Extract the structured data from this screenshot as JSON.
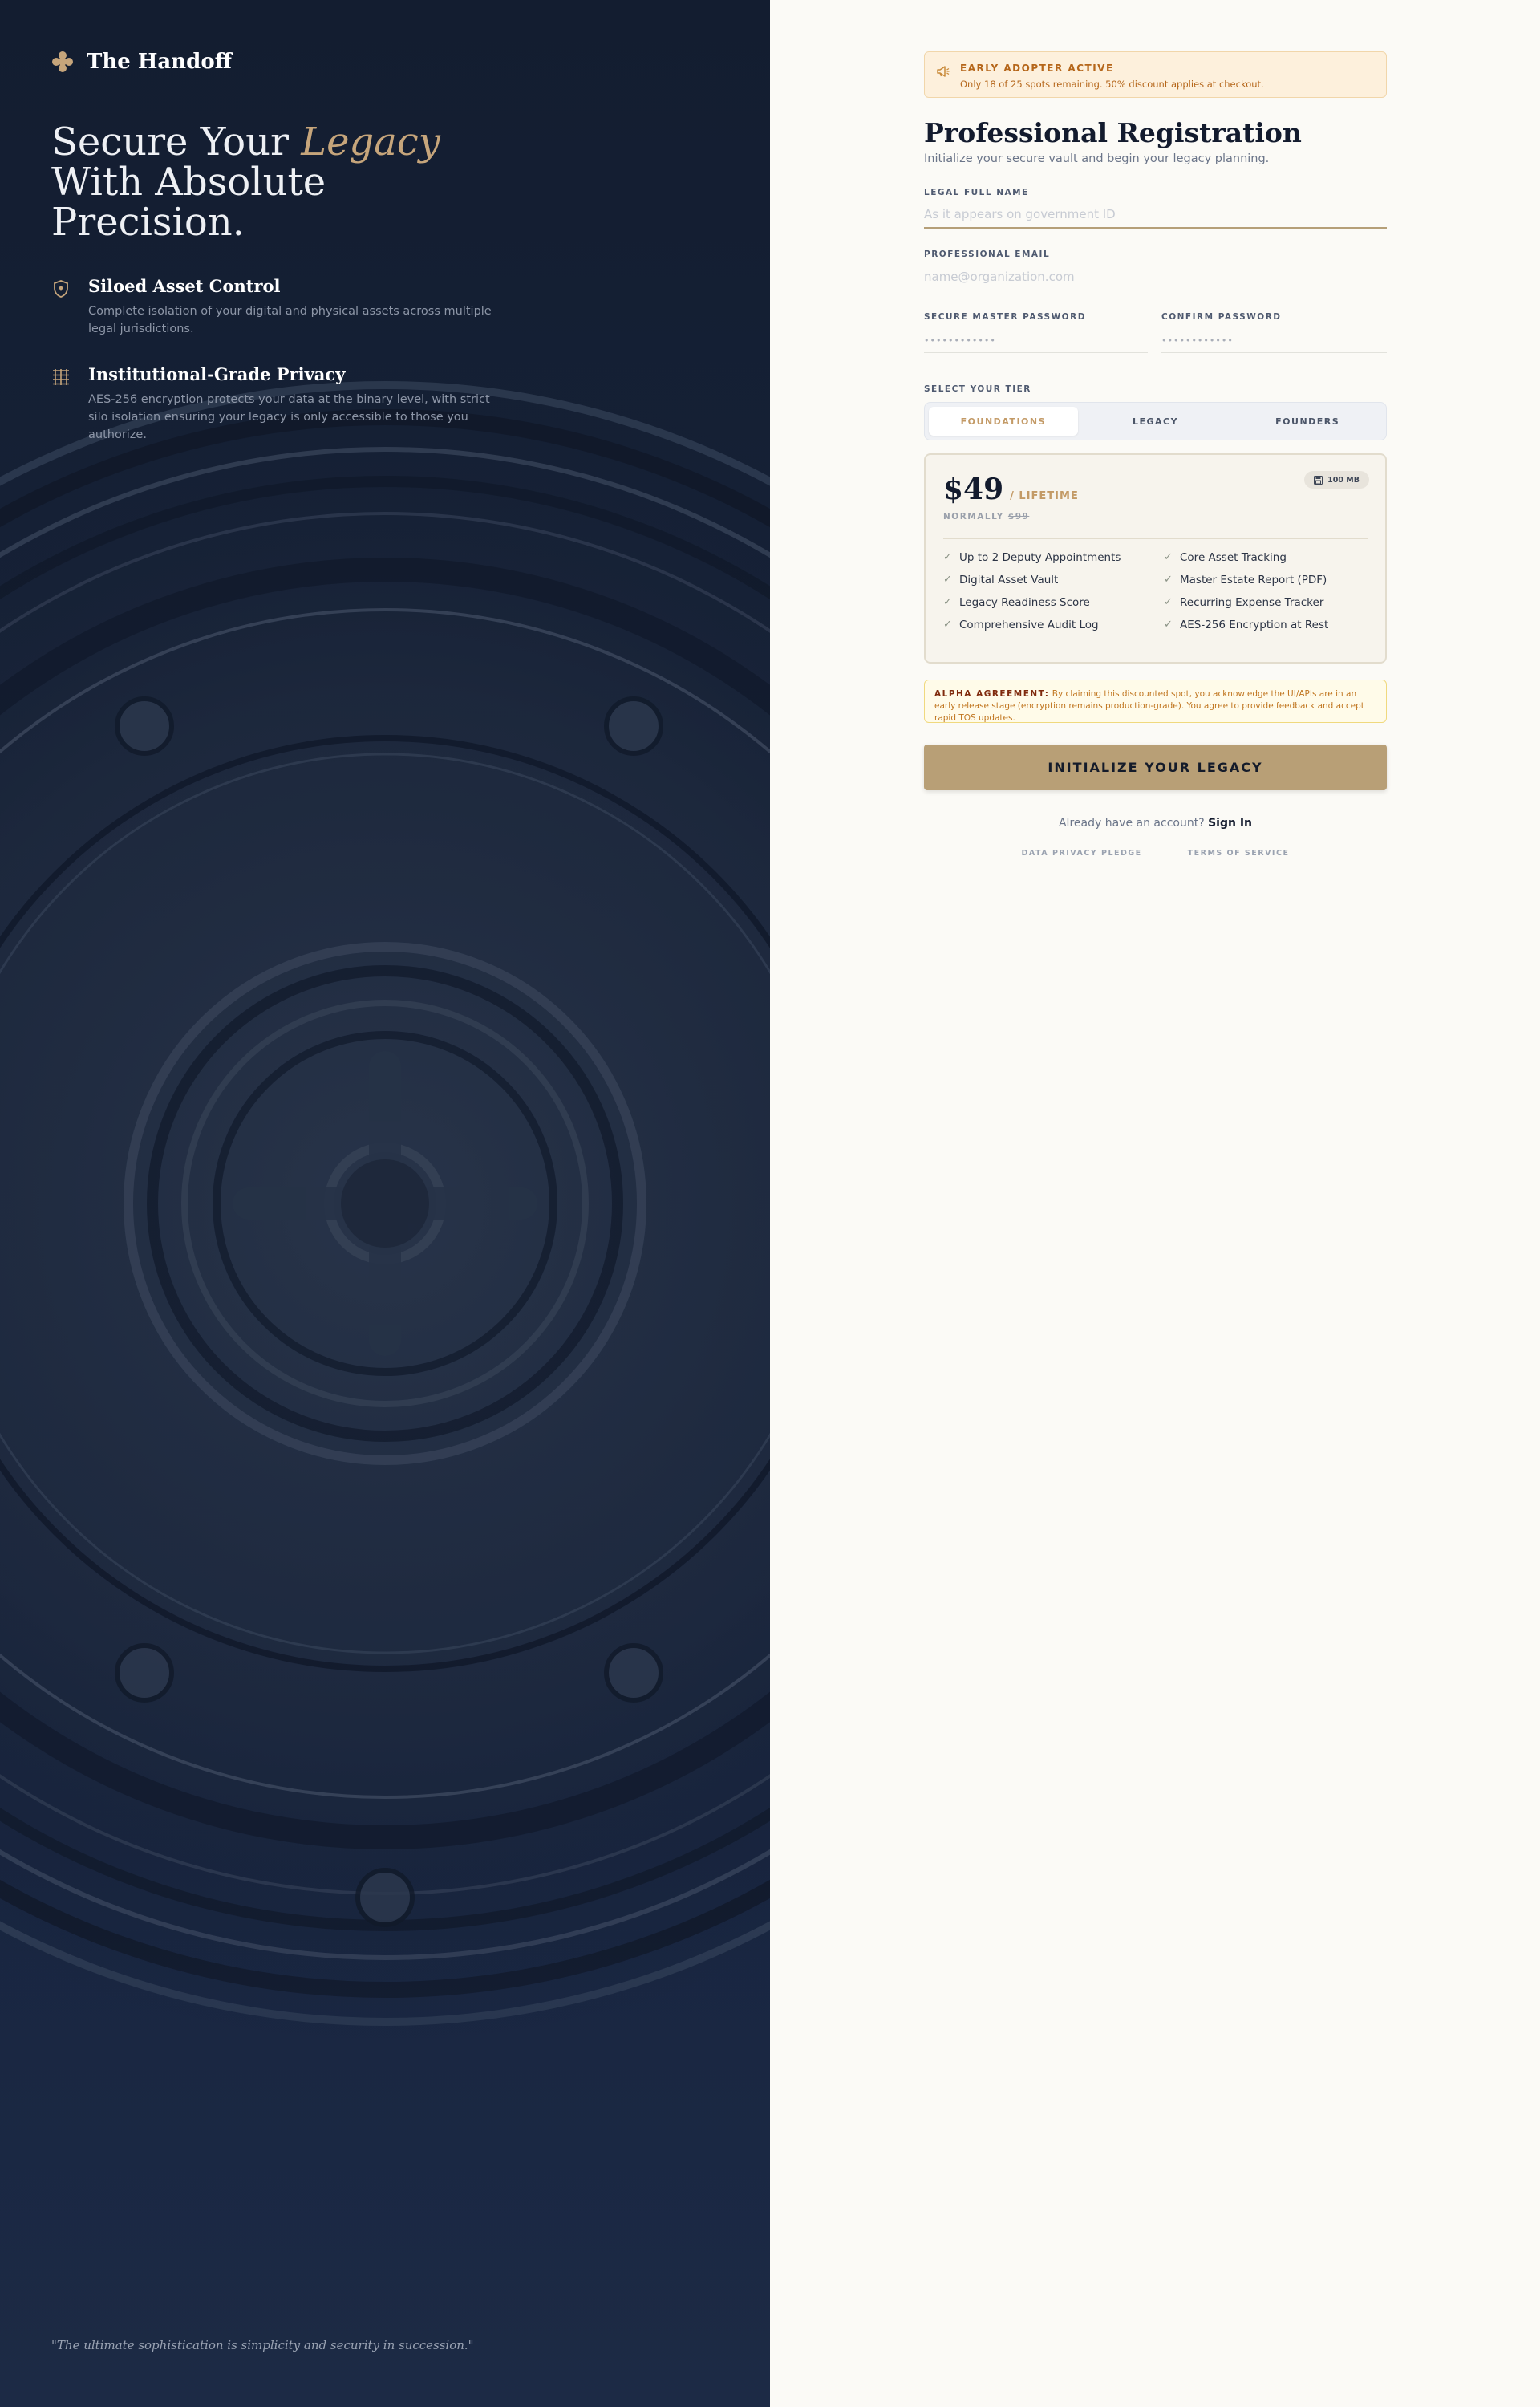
{
  "brand": {
    "name": "The Handoff"
  },
  "hero": {
    "line1": "Secure Your ",
    "accent": "Legacy",
    "line2": "With Absolute",
    "line3": "Precision."
  },
  "features": [
    {
      "title": "Siloed Asset Control",
      "description": "Complete isolation of your digital and physical assets across multiple legal jurisdictions.",
      "icon": "shield-icon"
    },
    {
      "title": "Institutional-Grade Privacy",
      "description": "AES-256 encryption protects your data at the binary level, with strict silo isolation ensuring your legacy is only accessible to those you authorize.",
      "icon": "lattice-icon"
    }
  ],
  "quote": "\"The ultimate sophistication is simplicity and security in succession.\"",
  "banner": {
    "title": "EARLY ADOPTER ACTIVE",
    "text": "Only 18 of 25 spots remaining. 50% discount applies at checkout.",
    "icon": "megaphone-icon"
  },
  "form": {
    "title": "Professional Registration",
    "subtitle": "Initialize your secure vault and begin your legacy planning.",
    "name_label": "LEGAL FULL NAME",
    "name_placeholder": "As it appears on government ID",
    "email_label": "PROFESSIONAL EMAIL",
    "email_placeholder": "name@organization.com",
    "password_label": "SECURE MASTER PASSWORD",
    "password_placeholder": "••••••••••••",
    "confirm_label": "CONFIRM PASSWORD",
    "confirm_placeholder": "••••••••••••",
    "tier_label": "SELECT YOUR TIER"
  },
  "tiers": [
    "FOUNDATIONS",
    "LEGACY",
    "FOUNDERS"
  ],
  "selected_tier": "FOUNDATIONS",
  "plan": {
    "price": "$49",
    "term": "/ LIFETIME",
    "normally_label": "NORMALLY",
    "normally_price": "$99",
    "storage": "100 MB",
    "features": [
      "Up to 2 Deputy Appointments",
      "Core Asset Tracking",
      "Digital Asset Vault",
      "Master Estate Report (PDF)",
      "Legacy Readiness Score",
      "Recurring Expense Tracker",
      "Comprehensive Audit Log",
      "AES-256 Encryption at Rest"
    ]
  },
  "alpha": {
    "label": "ALPHA AGREEMENT:",
    "text": " By claiming this discounted spot, you acknowledge the UI/APIs are in an early release stage (encryption remains production-grade). You agree to provide feedback and accept rapid TOS updates."
  },
  "cta": "INITIALIZE YOUR LEGACY",
  "signin": {
    "prompt": "Already have an account? ",
    "link": "Sign In"
  },
  "legal": {
    "privacy": "DATA PRIVACY PLEDGE",
    "terms": "TERMS OF SERVICE"
  },
  "colors": {
    "navy": "#131d30",
    "gold": "#c39a66",
    "cta": "#b89f76",
    "cream": "#fbfaf6"
  }
}
